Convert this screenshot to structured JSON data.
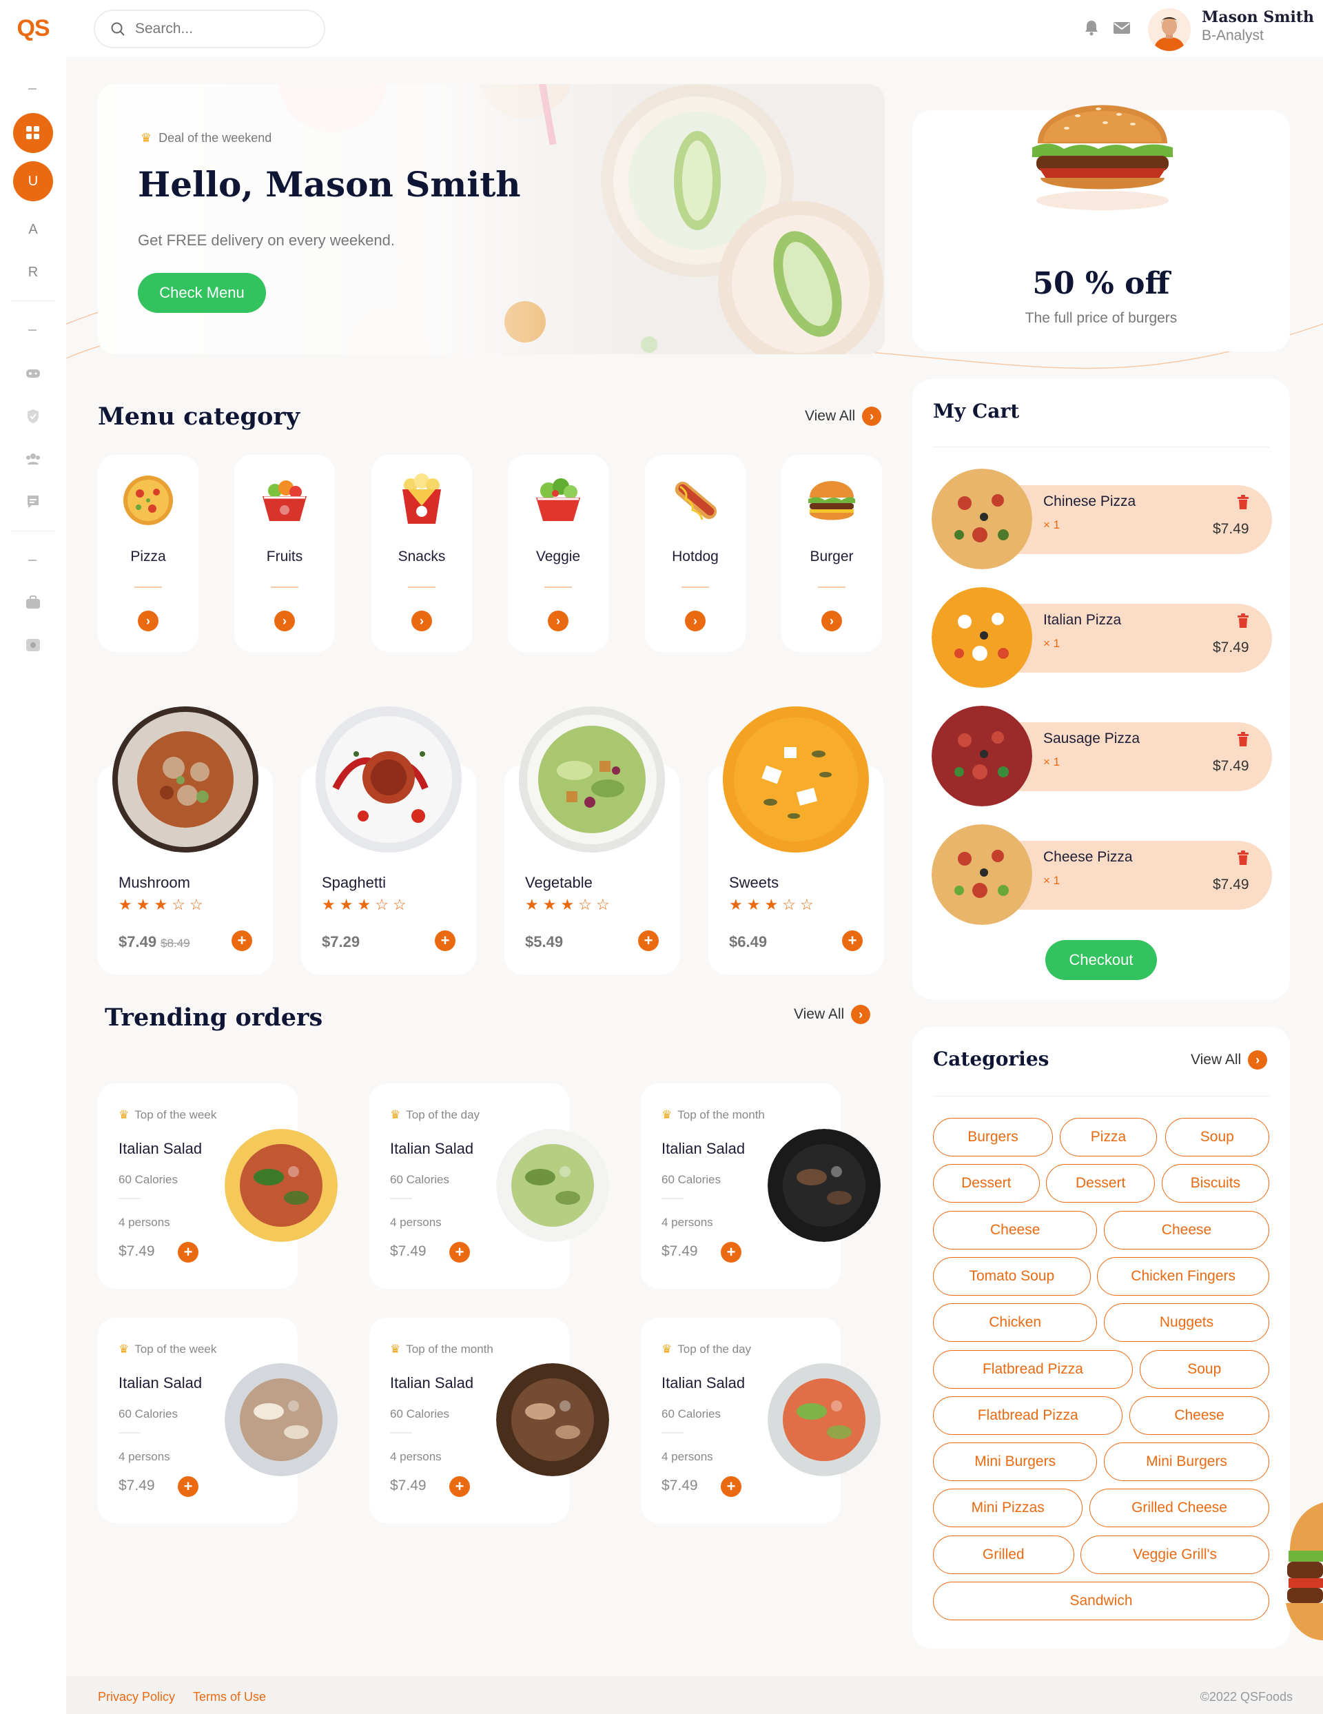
{
  "app": {
    "logo": "QS"
  },
  "search": {
    "placeholder": "Search..."
  },
  "user": {
    "name": "Mason Smith",
    "role": "B-Analyst"
  },
  "sidebar": {
    "avatar_letter": "U",
    "letters": [
      "A",
      "R"
    ]
  },
  "hero": {
    "tag": "Deal of the weekend",
    "title": "Hello, Mason Smith",
    "subtitle": "Get FREE delivery on every weekend.",
    "button": "Check Menu"
  },
  "promo": {
    "title": "50 % off",
    "subtitle": "The full price of burgers"
  },
  "menu_category": {
    "title": "Menu category",
    "view_all": "View All",
    "items": [
      {
        "label": "Pizza",
        "icon": "pizza-icon"
      },
      {
        "label": "Fruits",
        "icon": "fruit-bowl-icon"
      },
      {
        "label": "Snacks",
        "icon": "popcorn-icon"
      },
      {
        "label": "Veggie",
        "icon": "salad-bowl-icon"
      },
      {
        "label": "Hotdog",
        "icon": "hotdog-icon"
      },
      {
        "label": "Burger",
        "icon": "burger-icon"
      }
    ]
  },
  "dishes": [
    {
      "name": "Mushroom",
      "rating": 3,
      "max_rating": 5,
      "price": "$7.49",
      "old_price": "$8.49"
    },
    {
      "name": "Spaghetti",
      "rating": 3,
      "max_rating": 5,
      "price": "$7.29",
      "old_price": ""
    },
    {
      "name": "Vegetable",
      "rating": 3,
      "max_rating": 5,
      "price": "$5.49",
      "old_price": ""
    },
    {
      "name": "Sweets",
      "rating": 3,
      "max_rating": 5,
      "price": "$6.49",
      "old_price": ""
    }
  ],
  "trending": {
    "title": "Trending orders",
    "view_all": "View All",
    "items": [
      {
        "tag": "Top of the week",
        "name": "Italian Salad",
        "calories": "60 Calories",
        "persons": "4 persons",
        "price": "$7.49"
      },
      {
        "tag": "Top of the day",
        "name": "Italian Salad",
        "calories": "60 Calories",
        "persons": "4 persons",
        "price": "$7.49"
      },
      {
        "tag": "Top of the month",
        "name": "Italian Salad",
        "calories": "60 Calories",
        "persons": "4 persons",
        "price": "$7.49"
      },
      {
        "tag": "Top of the week",
        "name": "Italian Salad",
        "calories": "60 Calories",
        "persons": "4 persons",
        "price": "$7.49"
      },
      {
        "tag": "Top of the month",
        "name": "Italian Salad",
        "calories": "60 Calories",
        "persons": "4 persons",
        "price": "$7.49"
      },
      {
        "tag": "Top of the day",
        "name": "Italian Salad",
        "calories": "60 Calories",
        "persons": "4 persons",
        "price": "$7.49"
      }
    ]
  },
  "cart": {
    "title": "My Cart",
    "items": [
      {
        "name": "Chinese Pizza",
        "qty": "× 1",
        "price": "$7.49"
      },
      {
        "name": "Italian Pizza",
        "qty": "× 1",
        "price": "$7.49"
      },
      {
        "name": "Sausage Pizza",
        "qty": "× 1",
        "price": "$7.49"
      },
      {
        "name": "Cheese Pizza",
        "qty": "× 1",
        "price": "$7.49"
      }
    ],
    "checkout": "Checkout"
  },
  "categories": {
    "title": "Categories",
    "view_all": "View All",
    "tags": [
      "Burgers",
      "Pizza",
      "Soup",
      "Dessert",
      "Dessert",
      "Biscuits",
      "Cheese",
      "Cheese",
      "Tomato Soup",
      "Chicken Fingers",
      "Chicken",
      "Nuggets",
      "Flatbread Pizza",
      "Soup",
      "Flatbread Pizza",
      "Cheese",
      "Mini Burgers",
      "Mini Burgers",
      "Mini Pizzas",
      "Grilled Cheese",
      "Grilled",
      "Veggie Grill's",
      "Sandwich"
    ]
  },
  "footer": {
    "privacy": "Privacy Policy",
    "terms": "Terms of Use",
    "copyright": "©2022 QSFoods"
  },
  "colors": {
    "accent": "#ea6a12",
    "green": "#32c35f",
    "navy": "#0f1535",
    "cart_pill": "#fbdcc6"
  }
}
